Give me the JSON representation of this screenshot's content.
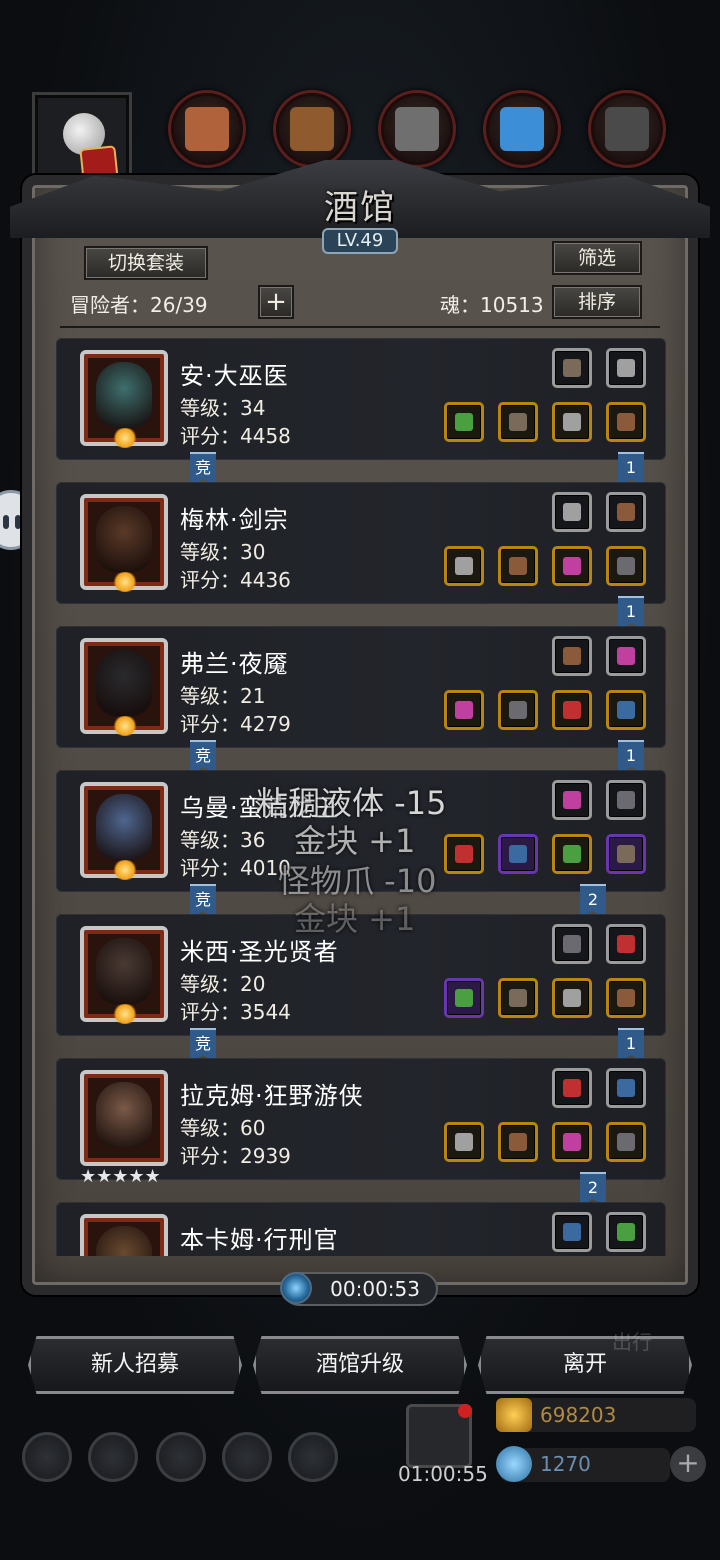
{
  "top_icons": [
    {
      "name": "leather-icon",
      "color": "#b0633a"
    },
    {
      "name": "wood-plank-icon",
      "color": "#8e5a2e"
    },
    {
      "name": "iron-ingot-icon",
      "color": "#6f6f6f"
    },
    {
      "name": "crystal-icon",
      "color": "#3c8fd6"
    },
    {
      "name": "dark-ingot-icon",
      "color": "#4a4a4a"
    }
  ],
  "panel": {
    "title": "酒馆",
    "level": "LV.49",
    "switch_label": "切换套装",
    "filter_label": "筛选",
    "sort_label": "排序",
    "plus_label": "+",
    "adventurers": "冒险者：26/39",
    "soul": "魂：10513"
  },
  "heroes": [
    {
      "name": "安·大巫医",
      "level": "等级：34",
      "score": "评分：4458",
      "tag_left": "竞",
      "tag_right": "1",
      "top_items": [
        "green-scroll-icon",
        "feather-icon"
      ],
      "bottom_items": [
        "staff-icon",
        "red-helmet-icon",
        "amulet-icon",
        "pink-gem-necklace-icon"
      ],
      "bottom_borders": [
        "gold",
        "gold",
        "gold",
        "gold"
      ],
      "face": "#3e6f6e"
    },
    {
      "name": "梅林·剑宗",
      "level": "等级：30",
      "score": "评分：4436",
      "tag_left": "",
      "tag_right": "1",
      "top_items": [
        "crossbow-icon",
        "stone-icon"
      ],
      "bottom_items": [
        "spear-icon",
        "armor-icon",
        "gauntlet-icon",
        "boots-icon"
      ],
      "bottom_borders": [
        "gold",
        "gold",
        "gold",
        "gold"
      ],
      "face": "#5a3a28"
    },
    {
      "name": "弗兰·夜魇",
      "level": "等级：21",
      "score": "评分：4279",
      "tag_left": "竞",
      "tag_right": "1",
      "top_items": [
        "horn-icon",
        "horn-icon"
      ],
      "bottom_items": [
        "torch-icon",
        "bracer-icon",
        "boots-icon",
        "red-shield-icon"
      ],
      "bottom_borders": [
        "gold",
        "gold",
        "gold",
        "gold"
      ],
      "face": "#2a2a2e"
    },
    {
      "name": "乌曼·蛮荒龙王",
      "level": "等级：36",
      "score": "评分：4010",
      "tag_left": "竞",
      "tag_right": "2",
      "top_items": [
        "pendant-icon",
        "stone-icon"
      ],
      "bottom_items": [
        "axe-icon",
        "purple-helmet-icon",
        "gauntlet-icon",
        "wood-plank-icon"
      ],
      "bottom_borders": [
        "gold",
        "purple",
        "gold",
        "purple"
      ],
      "face": "#4f6690"
    },
    {
      "name": "米西·圣光贤者",
      "level": "等级：20",
      "score": "评分：3544",
      "tag_left": "竞",
      "tag_right": "1",
      "top_items": [
        "bow-icon",
        "pendant-icon"
      ],
      "bottom_items": [
        "hammer-icon",
        "armor-icon",
        "necklace-icon",
        "ruby-ring-icon"
      ],
      "bottom_borders": [
        "purple",
        "gold",
        "gold",
        "gold"
      ],
      "face": "#4a3a34"
    },
    {
      "name": "拉克姆·狂野游侠",
      "level": "等级：60",
      "score": "评分：2939",
      "tag_left": "",
      "tag_right": "2",
      "top_items": [
        "dagger-icon",
        "wand-icon"
      ],
      "bottom_items": [
        "sword-icon",
        "bracer-icon",
        "boots-icon",
        "red-helmet-icon"
      ],
      "bottom_borders": [
        "gold",
        "gold",
        "gold",
        "gold"
      ],
      "face": "#7a5a48",
      "stars": "★★★★★"
    },
    {
      "name": "本卡姆·行刑官",
      "level": "",
      "score": "",
      "tag_left": "",
      "tag_right": "",
      "top_items": [
        "stone-icon",
        "pendant-icon"
      ],
      "bottom_items": [],
      "bottom_borders": [],
      "face": "#6a4a30"
    }
  ],
  "floating_text": {
    "line1": "粘稠液体 -15",
    "line2": "金块 +1",
    "line3": "怪物爪 -10",
    "line4": "金块 +1"
  },
  "timer": "00:00:53",
  "buttons": {
    "recruit": "新人招募",
    "upgrade": "酒馆升级",
    "leave": "离开"
  },
  "bottom": {
    "gift_timer": "01:00:55",
    "gold": "698203",
    "gems": "1270",
    "ghost_text": "出行"
  },
  "colors": {
    "tag_blue": "#2f5a8a",
    "gold_border": "#b8860b",
    "purple_border": "#6a36b0"
  }
}
